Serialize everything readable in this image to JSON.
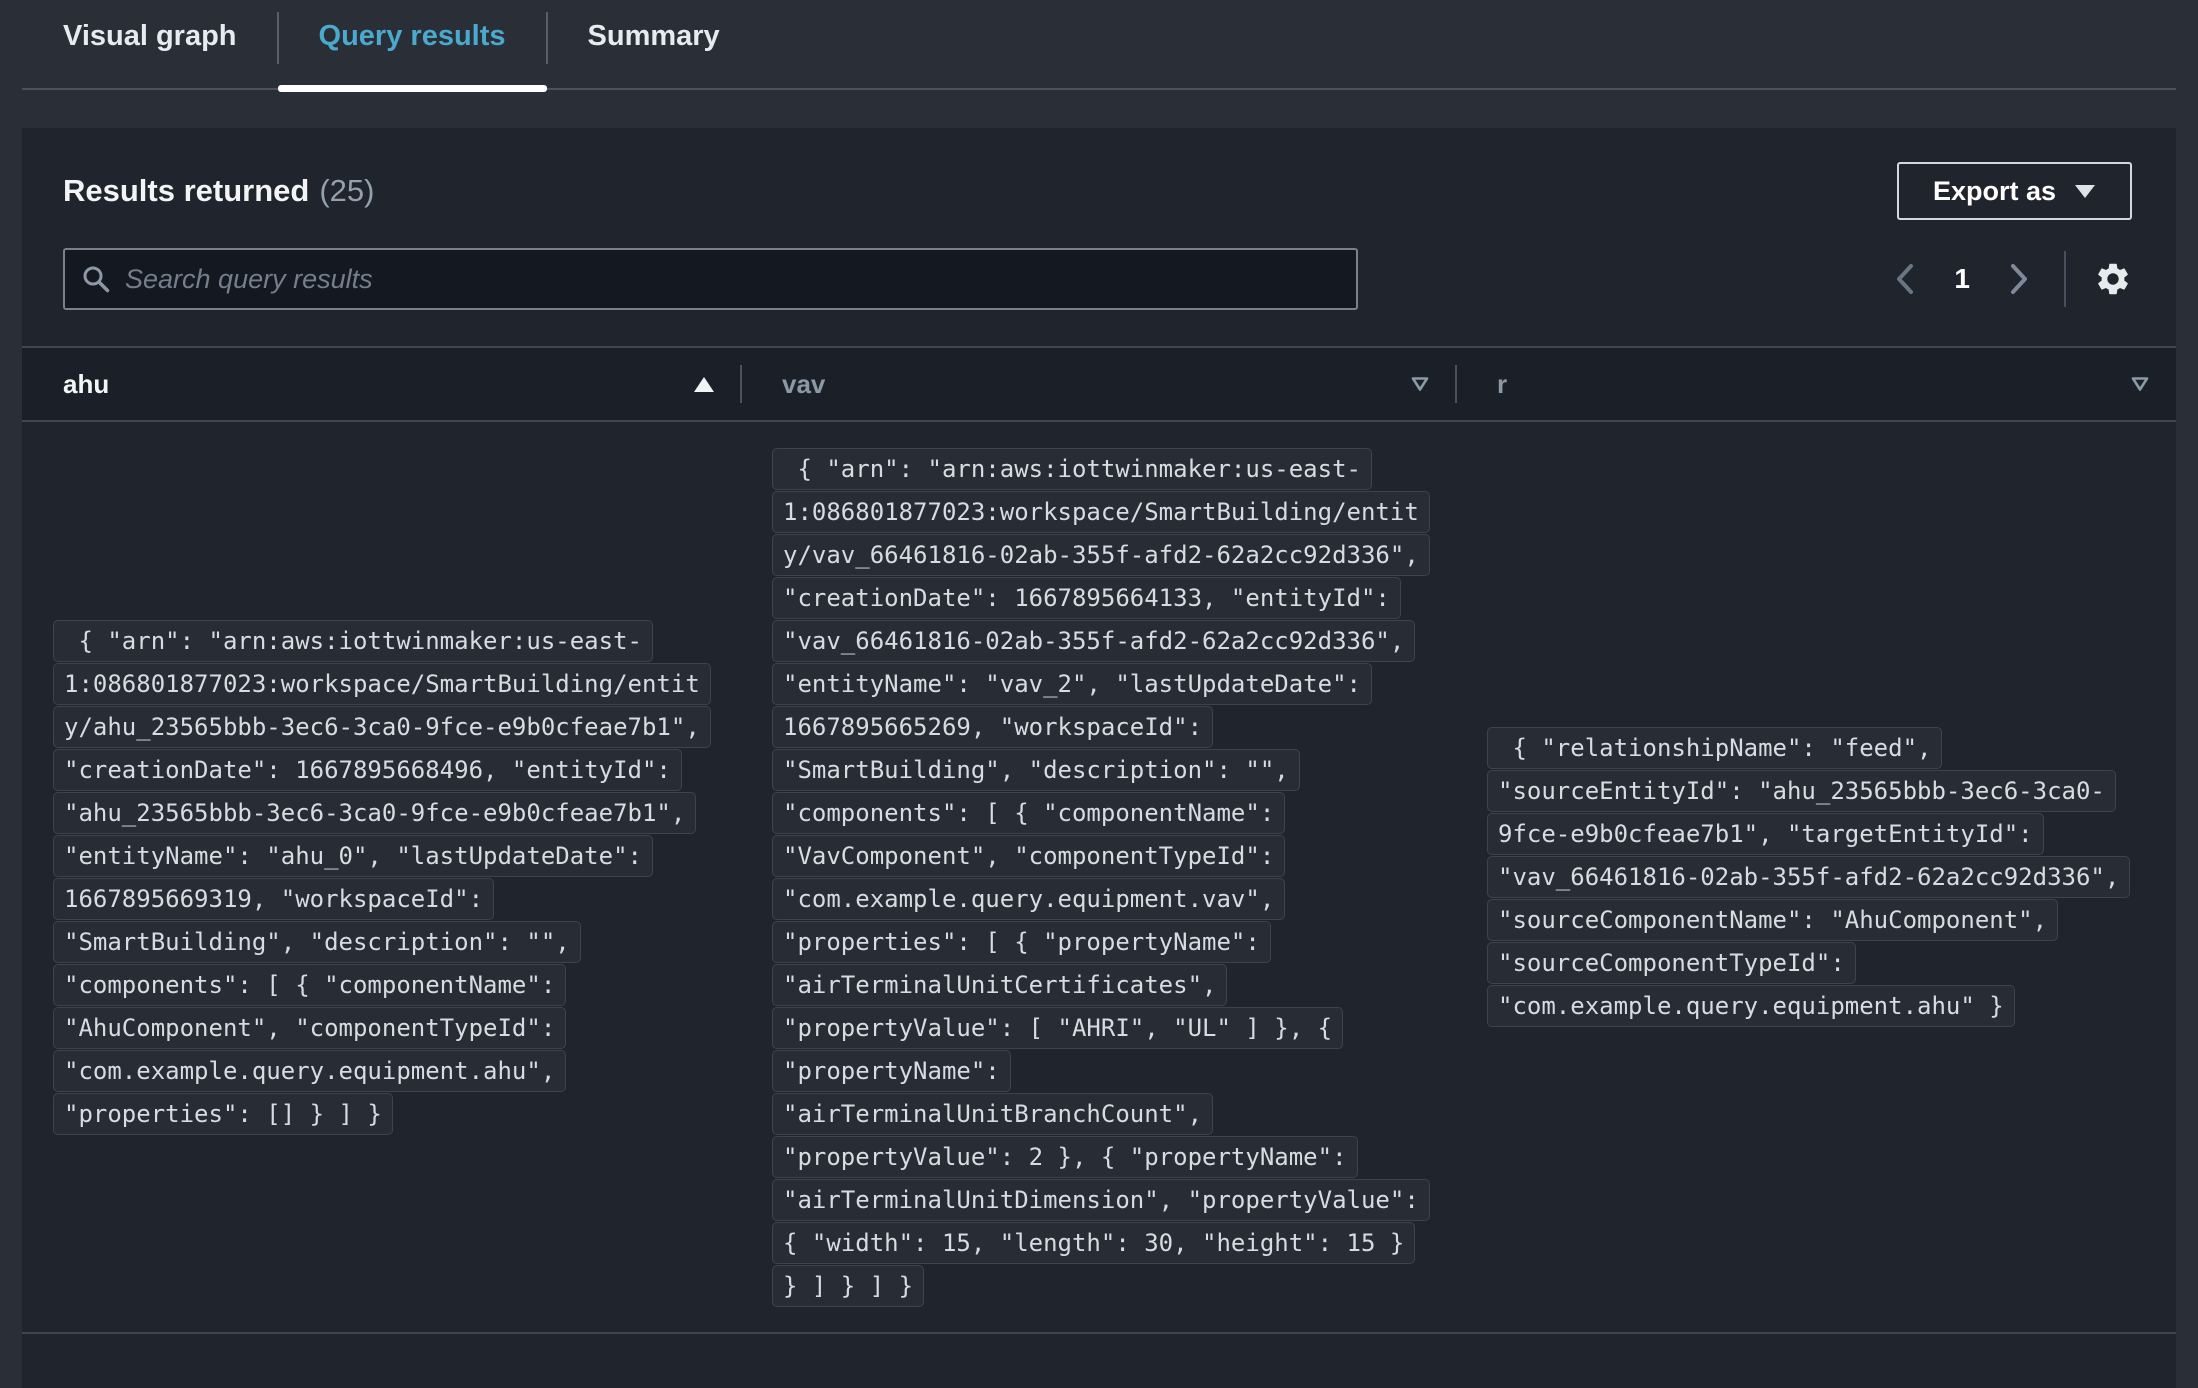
{
  "tabs": [
    {
      "label": "Visual graph",
      "active": false
    },
    {
      "label": "Query results",
      "active": true
    },
    {
      "label": "Summary",
      "active": false
    }
  ],
  "panel": {
    "title": "Results returned",
    "count": "(25)",
    "export_label": "Export as",
    "search_placeholder": "Search query results",
    "pagination": {
      "current_page": "1"
    }
  },
  "table": {
    "columns": [
      {
        "label": "ahu",
        "sort": "ascending"
      },
      {
        "label": "vav",
        "sort": "none"
      },
      {
        "label": "r",
        "sort": "none"
      }
    ],
    "rows": [
      {
        "ahu_lines": [
          " { \"arn\": \"arn:aws:iottwinmaker:us-east-",
          "1:086801877023:workspace/SmartBuilding/entit",
          "y/ahu_23565bbb-3ec6-3ca0-9fce-e9b0cfeae7b1\",",
          "\"creationDate\": 1667895668496, \"entityId\":",
          "\"ahu_23565bbb-3ec6-3ca0-9fce-e9b0cfeae7b1\",",
          "\"entityName\": \"ahu_0\", \"lastUpdateDate\":",
          "1667895669319, \"workspaceId\":",
          "\"SmartBuilding\", \"description\": \"\",",
          "\"components\": [ { \"componentName\":",
          "\"AhuComponent\", \"componentTypeId\":",
          "\"com.example.query.equipment.ahu\",",
          "\"properties\": [] } ] }"
        ],
        "vav_lines": [
          " { \"arn\": \"arn:aws:iottwinmaker:us-east-",
          "1:086801877023:workspace/SmartBuilding/entit",
          "y/vav_66461816-02ab-355f-afd2-62a2cc92d336\",",
          "\"creationDate\": 1667895664133, \"entityId\":",
          "\"vav_66461816-02ab-355f-afd2-62a2cc92d336\",",
          "\"entityName\": \"vav_2\", \"lastUpdateDate\":",
          "1667895665269, \"workspaceId\":",
          "\"SmartBuilding\", \"description\": \"\",",
          "\"components\": [ { \"componentName\":",
          "\"VavComponent\", \"componentTypeId\":",
          "\"com.example.query.equipment.vav\",",
          "\"properties\": [ { \"propertyName\":",
          "\"airTerminalUnitCertificates\",",
          "\"propertyValue\": [ \"AHRI\", \"UL\" ] }, {",
          "\"propertyName\":",
          "\"airTerminalUnitBranchCount\",",
          "\"propertyValue\": 2 }, { \"propertyName\":",
          "\"airTerminalUnitDimension\", \"propertyValue\":",
          "{ \"width\": 15, \"length\": 30, \"height\": 15 }",
          "} ] } ] }"
        ],
        "r_lines": [
          " { \"relationshipName\": \"feed\",",
          "\"sourceEntityId\": \"ahu_23565bbb-3ec6-3ca0-",
          "9fce-e9b0cfeae7b1\", \"targetEntityId\":",
          "\"vav_66461816-02ab-355f-afd2-62a2cc92d336\",",
          "\"sourceComponentName\": \"AhuComponent\",",
          "\"sourceComponentTypeId\":",
          "\"com.example.query.equipment.ahu\" }"
        ]
      }
    ]
  },
  "icons": {
    "search": "magnifier",
    "export_caret": "filled-triangle-down",
    "previous_page": "chevron-left",
    "next_page": "chevron-right",
    "settings": "gear",
    "sort_ascending": "filled-triangle-up",
    "sort_indicator": "outline-triangle-down"
  },
  "colors": {
    "active_tab_text": "#4aa9cd",
    "active_tab_underline": "#ffffff",
    "page_background": "#2a2e37",
    "panel_background": "#20242c",
    "table_header_background": "#1b2028",
    "sorted_header_text": "#f3f6f8",
    "unsorted_header_text": "#8b99a6",
    "json_text": "#d7dbe2"
  }
}
